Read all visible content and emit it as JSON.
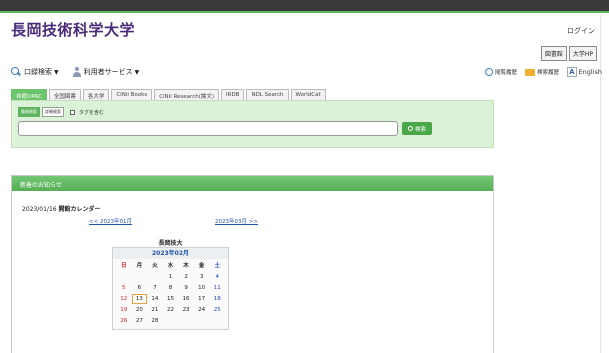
{
  "brand": "長岡技術科学大学",
  "header": {
    "login_label": "ログイン",
    "lang_buttons": [
      "図書館",
      "大学HP"
    ]
  },
  "menu": {
    "catalog_search": "口録検索",
    "user_service": "利用者サービス"
  },
  "right_links": {
    "history": "閲覧履歴",
    "search_history": "検索履歴",
    "english": "English"
  },
  "tabs": [
    "自館OPAC",
    "全国図書",
    "各大学",
    "CiNii Books",
    "CiNii Research(論文)",
    "IRDB",
    "NDL Search",
    "WorldCat"
  ],
  "search": {
    "mode_simple": "簡易検索",
    "mode_detail": "詳細検索",
    "tag_checkbox_label": "タグを含む",
    "input_value": "",
    "button_label": "検索"
  },
  "news": {
    "heading": "新着のお知らせ",
    "date": "2023/01/16",
    "title": "開館カレンダー"
  },
  "calendar": {
    "prev_link": "<< 2023年01月",
    "next_link": "2023年03月 >>",
    "library_name": "長岡技大",
    "month_label": "2023年02月",
    "weekdays": [
      "日",
      "月",
      "火",
      "水",
      "木",
      "金",
      "土"
    ],
    "days": [
      "",
      "",
      "",
      "1",
      "2",
      "3",
      "4",
      "5",
      "6",
      "7",
      "8",
      "9",
      "10",
      "11",
      "12",
      "13",
      "14",
      "15",
      "16",
      "17",
      "18",
      "19",
      "20",
      "21",
      "22",
      "23",
      "24",
      "25",
      "26",
      "27",
      "28",
      "",
      "",
      "",
      ""
    ],
    "today": "13"
  },
  "colors": {
    "brand": "#4a2b7a",
    "accent_green": "#5fb45f",
    "panel_green": "#dcf2d8",
    "link_blue": "#2255aa",
    "sunday_red": "#cc2222",
    "saturday_blue": "#2244bb"
  },
  "icons": [
    "search-icon",
    "user-icon",
    "history-icon",
    "folder-icon",
    "english-a-icon"
  ]
}
